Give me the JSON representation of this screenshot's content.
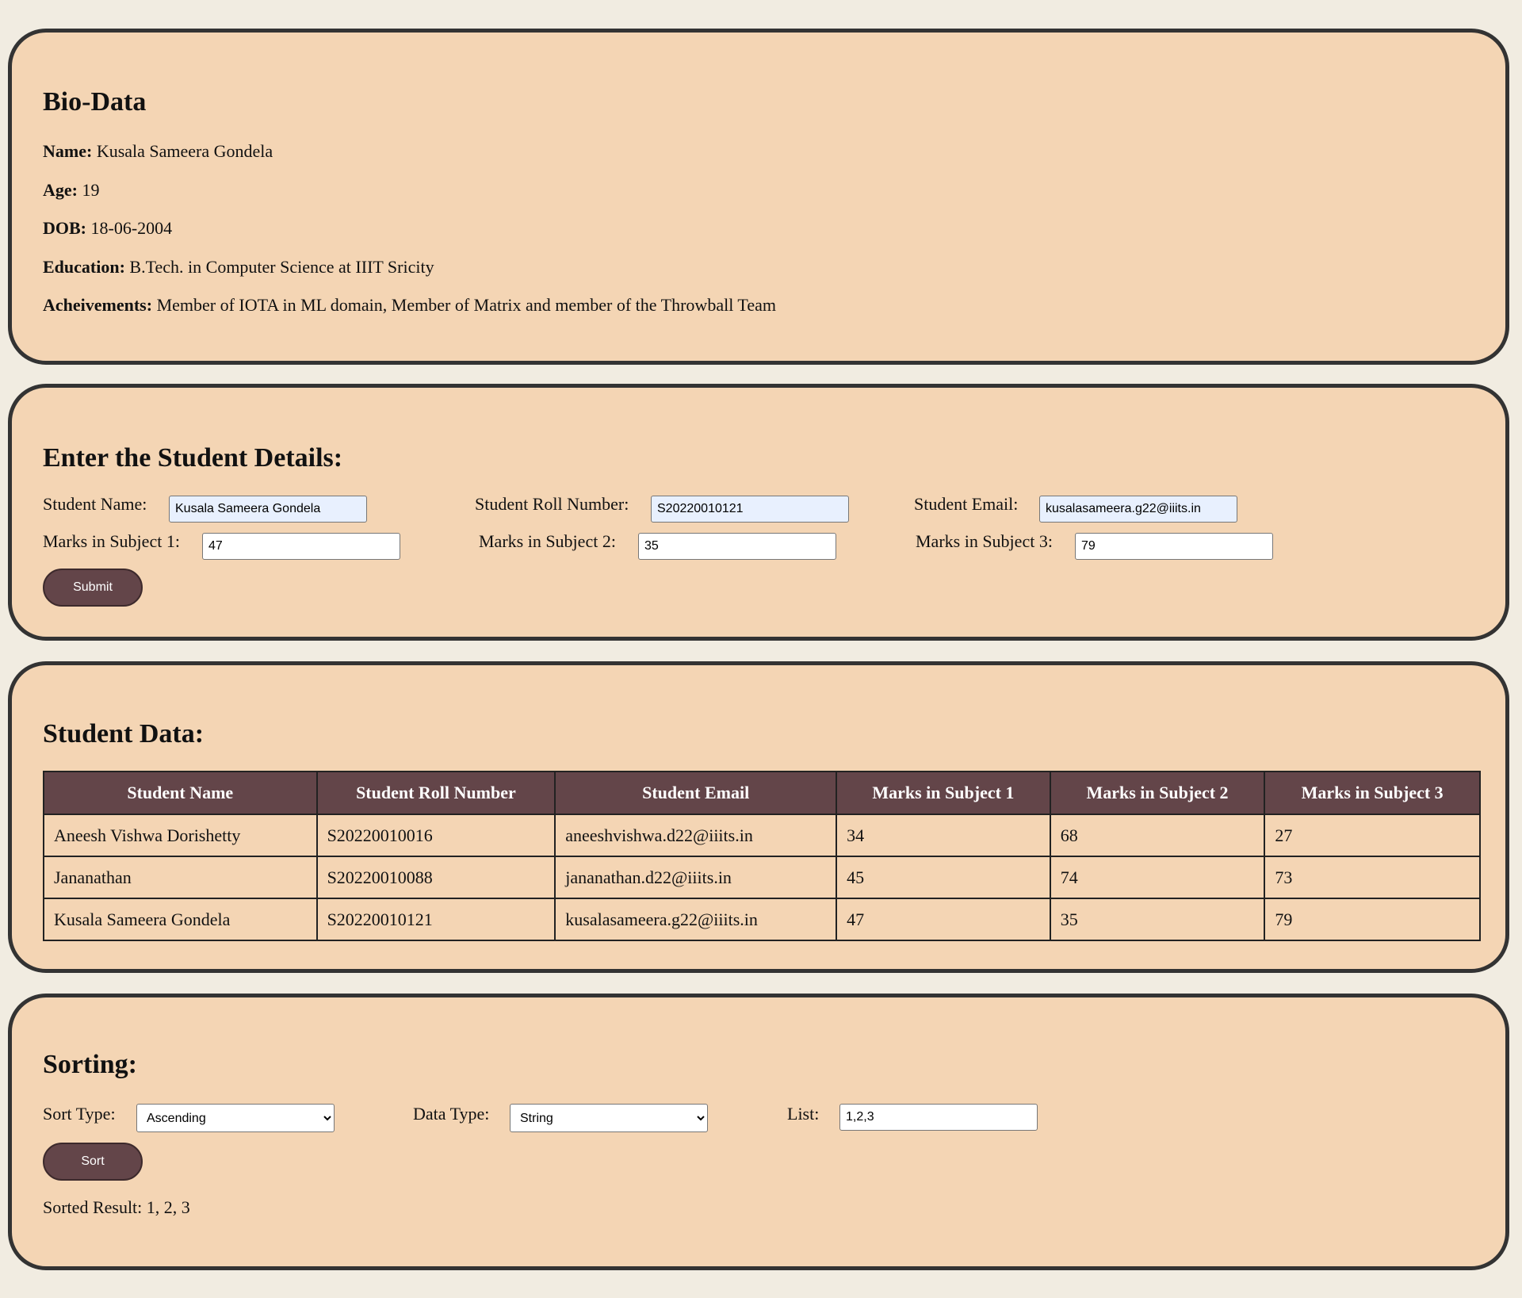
{
  "bio": {
    "title": "Bio-Data",
    "name_label": "Name:",
    "name": "Kusala Sameera Gondela",
    "age_label": "Age:",
    "age": "19",
    "dob_label": "DOB:",
    "dob": "18-06-2004",
    "education_label": "Education:",
    "education": "B.Tech. in Computer Science at IIIT Sricity",
    "achievements_label": "Acheivements:",
    "achievements": "Member of IOTA in ML domain, Member of Matrix and member of the Throwball Team"
  },
  "form": {
    "title": "Enter the Student Details:",
    "name_label": "Student Name:",
    "name_value": "Kusala Sameera Gondela",
    "roll_label": "Student Roll Number:",
    "roll_value": "S20220010121",
    "email_label": "Student Email:",
    "email_value": "kusalasameera.g22@iiits.in",
    "marks1_label": "Marks in Subject 1:",
    "marks1_value": "47",
    "marks2_label": "Marks in Subject 2:",
    "marks2_value": "35",
    "marks3_label": "Marks in Subject 3:",
    "marks3_value": "79",
    "submit_label": "Submit"
  },
  "table": {
    "title": "Student Data:",
    "headers": [
      "Student Name",
      "Student Roll Number",
      "Student Email",
      "Marks in Subject 1",
      "Marks in Subject 2",
      "Marks in Subject 3"
    ],
    "rows": [
      [
        "Aneesh Vishwa Dorishetty",
        "S20220010016",
        "aneeshvishwa.d22@iiits.in",
        "34",
        "68",
        "27"
      ],
      [
        "Jananathan",
        "S20220010088",
        "jananathan.d22@iiits.in",
        "45",
        "74",
        "73"
      ],
      [
        "Kusala Sameera Gondela",
        "S20220010121",
        "kusalasameera.g22@iiits.in",
        "47",
        "35",
        "79"
      ]
    ]
  },
  "sorting": {
    "title": "Sorting:",
    "sort_type_label": "Sort Type:",
    "sort_type_value": "Ascending",
    "data_type_label": "Data Type:",
    "data_type_value": "String",
    "list_label": "List:",
    "list_value": "1,2,3",
    "sort_button_label": "Sort",
    "result_text": "Sorted Result: 1, 2, 3"
  },
  "colors": {
    "page_background": "#f1ece1",
    "card_background": "#f4d5b4",
    "card_border": "#333333",
    "accent": "#634549",
    "autofill_input": "#e8f0fe"
  }
}
